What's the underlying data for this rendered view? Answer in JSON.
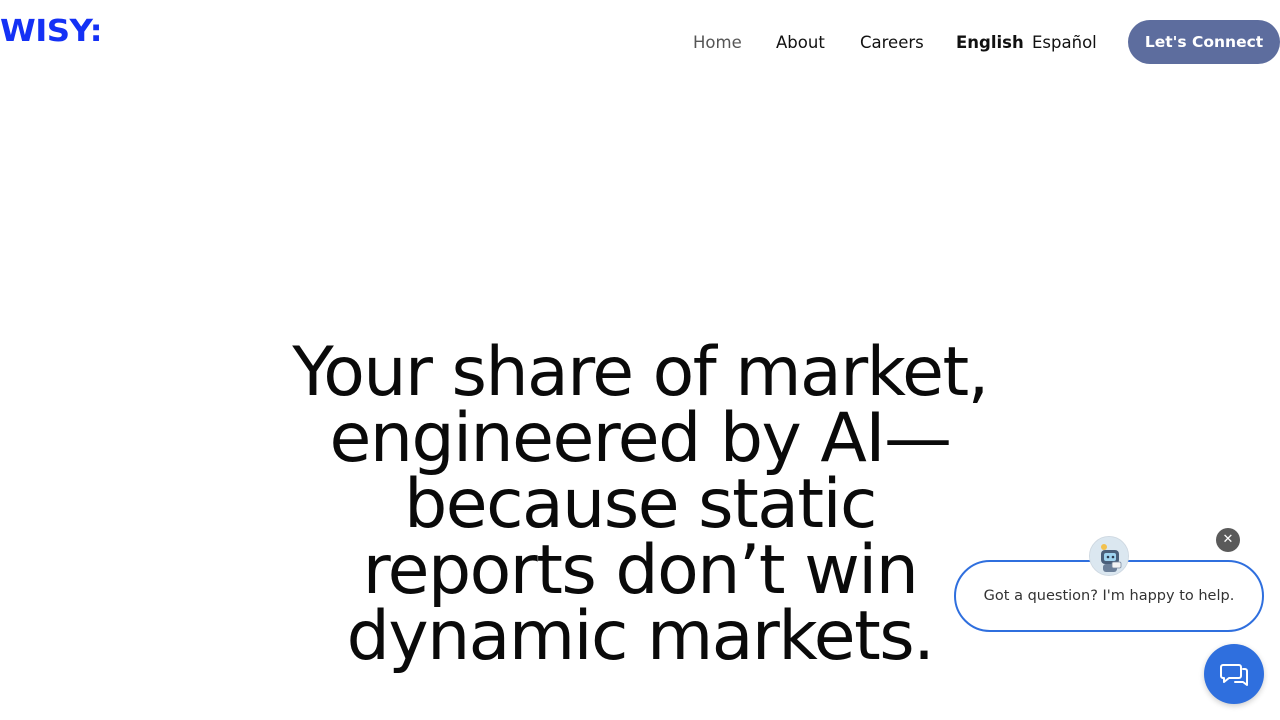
{
  "header": {
    "logo_text": "WISY:",
    "nav": {
      "home": "Home",
      "about": "About",
      "careers": "Careers",
      "english": "English",
      "espanol": "Español"
    },
    "cta_label": "Let's Connect"
  },
  "hero": {
    "lines": [
      "Your share of market,",
      "engineered by AI—",
      "because static",
      "reports don’t win",
      "dynamic markets."
    ]
  },
  "chat": {
    "close_glyph": "✕",
    "prompt": "Got a question? I'm happy to help.",
    "avatar_icon": "robot-avatar-icon",
    "launcher_icon": "chat-bubbles-icon"
  },
  "colors": {
    "brand": "#1431f5",
    "cta": "#5d6d9e",
    "chat": "#2f6fde"
  }
}
